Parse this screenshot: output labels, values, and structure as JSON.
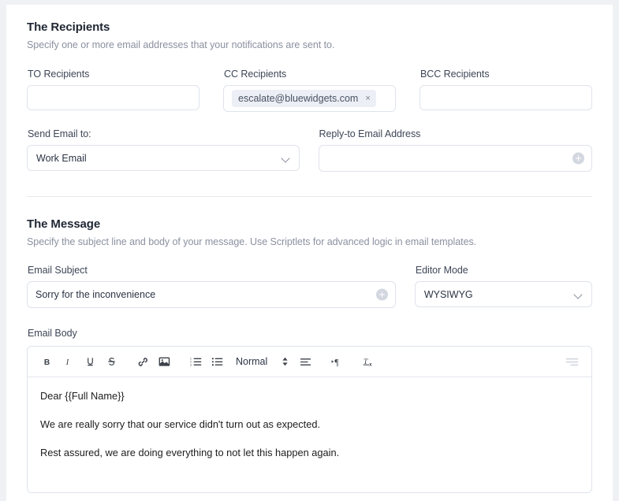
{
  "recipients": {
    "title": "The Recipients",
    "subtitle": "Specify one or more email addresses that your notifications are sent to.",
    "to": {
      "label": "TO Recipients",
      "value": "",
      "placeholder": ""
    },
    "cc": {
      "label": "CC Recipients",
      "chip": "escalate@bluewidgets.com",
      "chip_remove": "×"
    },
    "bcc": {
      "label": "BCC Recipients",
      "value": "",
      "placeholder": ""
    },
    "send_email_to": {
      "label": "Send Email to:",
      "value": "Work Email"
    },
    "reply_to": {
      "label": "Reply-to Email Address",
      "value": "",
      "placeholder": ""
    }
  },
  "message": {
    "title": "The Message",
    "subtitle": "Specify the subject line and body of your message. Use Scriptlets for advanced logic in email templates.",
    "subject": {
      "label": "Email Subject",
      "value": "Sorry for the inconvenience"
    },
    "editor_mode": {
      "label": "Editor Mode",
      "value": "WYSIWYG"
    },
    "body": {
      "label": "Email Body"
    }
  },
  "toolbar": {
    "bold": "B",
    "italic": "I",
    "underline": "U",
    "strikethrough": "S",
    "link": "link-icon",
    "image": "image-icon",
    "ordered_list": "ordered-list-icon",
    "bullet_list": "bullet-list-icon",
    "format": "Normal",
    "align": "align-icon",
    "text_direction": "text-direction-icon",
    "clear_format": "clear-formatting-icon",
    "overflow": "align-right-icon"
  },
  "body_paragraphs": [
    "Dear  {{Full Name}}",
    "We are really sorry that our service didn't turn out as expected.",
    "Rest assured, we are doing everything to not let this happen again."
  ],
  "colors": {
    "page_bg": "#f0f1f4",
    "card_bg": "#ffffff",
    "border": "#dfe3eb",
    "heading": "#1f2733",
    "muted": "#8b91a0",
    "chip_bg": "#eceff5"
  }
}
